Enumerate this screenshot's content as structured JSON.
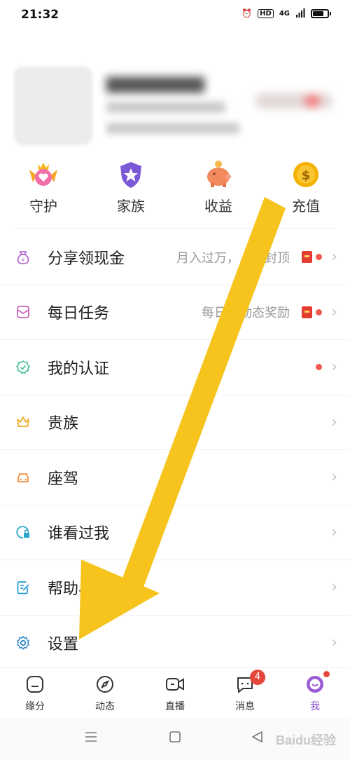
{
  "status_bar": {
    "time": "21:32",
    "network": "4G"
  },
  "profile": {
    "avatar": "blurred-avatar"
  },
  "quick_actions": [
    {
      "label": "守护",
      "icon": "guardian-crown-heart-icon"
    },
    {
      "label": "家族",
      "icon": "family-star-shield-icon"
    },
    {
      "label": "收益",
      "icon": "piggy-bank-icon"
    },
    {
      "label": "充值",
      "icon": "gold-coin-icon"
    }
  ],
  "menu": [
    {
      "label": "分享领现金",
      "hint": "月入过万，上不封顶",
      "icon": "money-bag-icon",
      "red_packet": true,
      "dot": true
    },
    {
      "label": "每日任务",
      "hint": "每日发动态奖励",
      "icon": "task-envelope-icon",
      "red_packet": true,
      "dot": true
    },
    {
      "label": "我的认证",
      "hint": "",
      "icon": "verified-badge-icon",
      "red_packet": false,
      "dot": true
    },
    {
      "label": "贵族",
      "hint": "",
      "icon": "crown-icon",
      "red_packet": false,
      "dot": false
    },
    {
      "label": "座驾",
      "hint": "",
      "icon": "car-icon",
      "red_packet": false,
      "dot": false
    },
    {
      "label": "谁看过我",
      "hint": "",
      "icon": "visitor-lock-icon",
      "red_packet": false,
      "dot": false
    },
    {
      "label": "帮助与反馈",
      "hint": "",
      "icon": "feedback-edit-icon",
      "red_packet": false,
      "dot": false
    },
    {
      "label": "设置",
      "hint": "",
      "icon": "gear-icon",
      "red_packet": false,
      "dot": false
    }
  ],
  "tabs": [
    {
      "label": "缘分",
      "icon": "home-icon",
      "active": false
    },
    {
      "label": "动态",
      "icon": "compass-icon",
      "active": false
    },
    {
      "label": "直播",
      "icon": "video-camera-icon",
      "active": false
    },
    {
      "label": "消息",
      "icon": "chat-bubble-icon",
      "active": false,
      "badge": "4"
    },
    {
      "label": "我",
      "icon": "me-avatar-icon",
      "active": true,
      "dot": true
    }
  ],
  "watermark": "Baidu经验",
  "colors": {
    "accent": "#8a50c7",
    "annotation_arrow": "#f6c41d",
    "badge": "#e5473b"
  }
}
